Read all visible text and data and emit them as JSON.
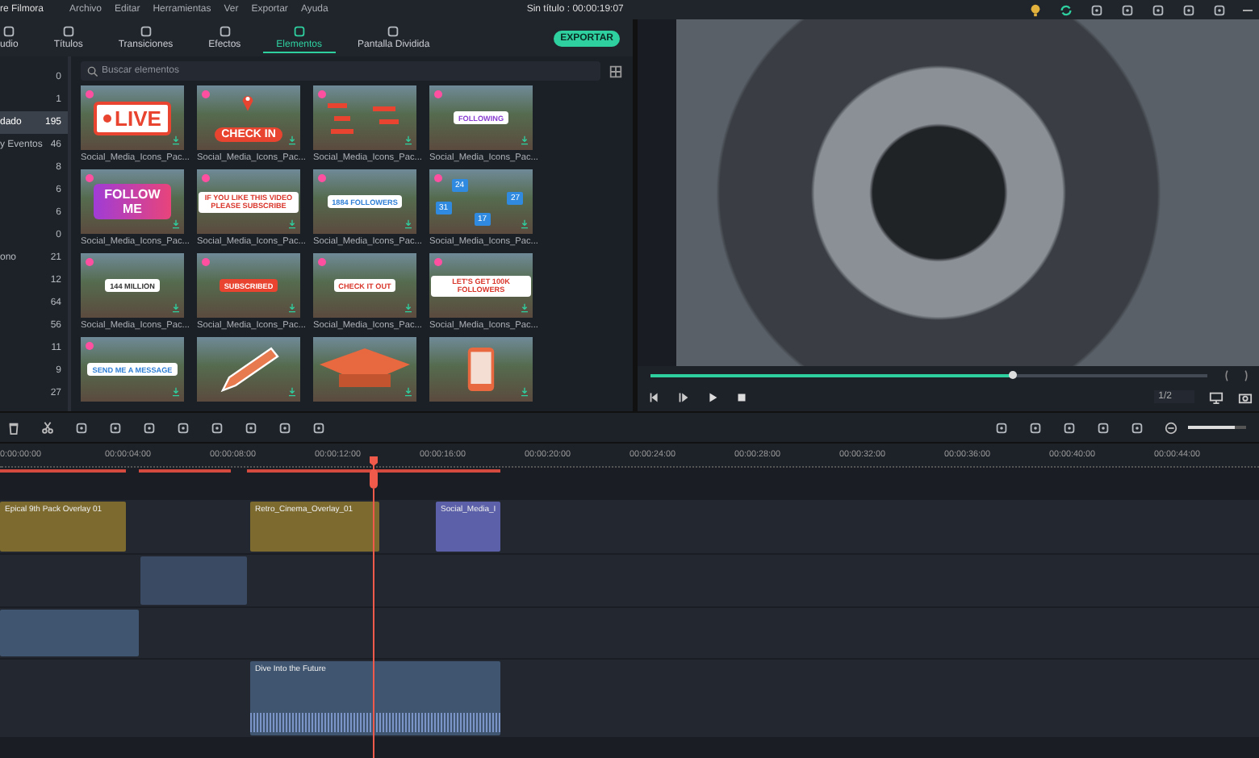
{
  "app": {
    "title": "re Filmora",
    "menu": [
      "Archivo",
      "Editar",
      "Herramientas",
      "Ver",
      "Exportar",
      "Ayuda"
    ],
    "project": "Sin título : 00:00:19:07"
  },
  "tabs": [
    {
      "label": "udio",
      "selected": false
    },
    {
      "label": "Títulos",
      "selected": false
    },
    {
      "label": "Transiciones",
      "selected": false
    },
    {
      "label": "Efectos",
      "selected": false
    },
    {
      "label": "Elementos",
      "selected": true
    },
    {
      "label": "Pantalla Dividida",
      "selected": false
    }
  ],
  "export_button": "EXPORTAR",
  "categories": [
    {
      "count": "0",
      "selected": false
    },
    {
      "count": "1",
      "selected": false
    },
    {
      "label": "dado",
      "count": "195",
      "selected": true
    },
    {
      "label": "y Eventos",
      "count": "46",
      "selected": false
    },
    {
      "count": "8",
      "selected": false
    },
    {
      "count": "6",
      "selected": false
    },
    {
      "count": "6",
      "selected": false
    },
    {
      "count": "0",
      "selected": false
    },
    {
      "label": "ono",
      "count": "21",
      "selected": false
    },
    {
      "count": "12",
      "selected": false
    },
    {
      "count": "64",
      "selected": false
    },
    {
      "count": "56",
      "selected": false
    },
    {
      "count": "11",
      "selected": false
    },
    {
      "count": "9",
      "selected": false
    },
    {
      "count": "27",
      "selected": false
    }
  ],
  "search": {
    "placeholder": "Buscar elementos"
  },
  "elements": [
    {
      "kind": "live",
      "sticker": "LIVE",
      "premium": true,
      "caption": "Social_Media_Icons_Pac..."
    },
    {
      "kind": "pin",
      "sticker": "CHECK IN",
      "premium": true,
      "caption": "Social_Media_Icons_Pac..."
    },
    {
      "kind": "scatter",
      "premium": true,
      "caption": "Social_Media_Icons_Pac..."
    },
    {
      "kind": "label",
      "sticker": "FOLLOWING",
      "color": "#8a3fd1",
      "premium": true,
      "caption": "Social_Media_Icons_Pac..."
    },
    {
      "kind": "gradient",
      "sticker": "FOLLOW ME",
      "premium": true,
      "caption": "Social_Media_Icons_Pac..."
    },
    {
      "kind": "label",
      "sticker": "IF YOU LIKE THIS VIDEO PLEASE SUBSCRIBE",
      "color": "#d9362b",
      "premium": true,
      "caption": "Social_Media_Icons_Pac..."
    },
    {
      "kind": "label",
      "sticker": "1884 FOLLOWERS",
      "color": "#2f7fd6",
      "premium": true,
      "caption": "Social_Media_Icons_Pac..."
    },
    {
      "kind": "counters",
      "counters": [
        "24",
        "31",
        "17",
        "27"
      ],
      "premium": true,
      "caption": "Social_Media_Icons_Pac..."
    },
    {
      "kind": "label",
      "sticker": "144 MILLION",
      "color": "#333333",
      "premium": true,
      "caption": "Social_Media_Icons_Pac..."
    },
    {
      "kind": "label",
      "sticker": "SUBSCRIBED",
      "color": "#e8442f",
      "filled": true,
      "premium": true,
      "caption": "Social_Media_Icons_Pac..."
    },
    {
      "kind": "label",
      "sticker": "CHECK IT OUT",
      "color": "#d9362b",
      "premium": true,
      "caption": "Social_Media_Icons_Pac..."
    },
    {
      "kind": "label",
      "sticker": "LET'S GET 100K FOLLOWERS",
      "color": "#d9362b",
      "premium": true,
      "caption": "Social_Media_Icons_Pac..."
    },
    {
      "kind": "label",
      "sticker": "SEND ME A MESSAGE",
      "color": "#2f7fd6",
      "premium": true
    },
    {
      "kind": "pencil",
      "premium": false
    },
    {
      "kind": "cap",
      "premium": false
    },
    {
      "kind": "phone",
      "premium": false
    }
  ],
  "preview": {
    "level": 0.65,
    "page": "1/2"
  },
  "timeline": {
    "ruler": [
      "0:00:00:00",
      "00:00:04:00",
      "00:00:08:00",
      "00:00:12:00",
      "00:00:16:00",
      "00:00:20:00",
      "00:00:24:00",
      "00:00:28:00",
      "00:00:32:00",
      "00:00:36:00",
      "00:00:40:00",
      "00:00:44:00"
    ],
    "zoom": {
      "level": 0.8
    },
    "tracks": [
      {
        "clips": [
          {
            "kind": "overlay",
            "label": "Epical 9th Pack Overlay 01",
            "color": "#7c6a2f"
          },
          {
            "kind": "overlay",
            "label": "Retro_Cinema_Overlay_01",
            "color": "#7c6a2f"
          },
          {
            "kind": "overlay",
            "label": "Social_Media_I",
            "color": "#5b60a8"
          }
        ]
      },
      {
        "clips": [
          {
            "kind": "image"
          }
        ]
      },
      {
        "clips": [
          {
            "kind": "video"
          }
        ]
      },
      {
        "clips": [
          {
            "kind": "video",
            "label": "Dive Into the Future"
          }
        ]
      }
    ]
  }
}
